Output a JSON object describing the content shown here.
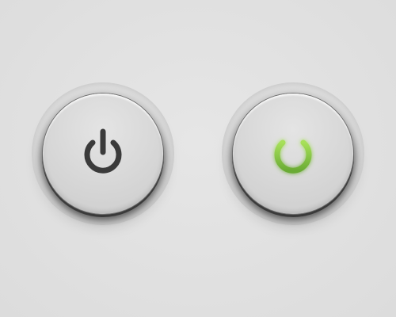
{
  "buttons": [
    {
      "state": "off",
      "icon": "power-icon",
      "icon_color": "#3b3b3b"
    },
    {
      "state": "on",
      "icon": "power-icon",
      "icon_color": "#7dc040",
      "glow_color": "#b8f06a"
    }
  ],
  "colors": {
    "background": "#e2e2e2",
    "button_face": "#d9d9d9",
    "button_rim": "#3a3a3a"
  }
}
